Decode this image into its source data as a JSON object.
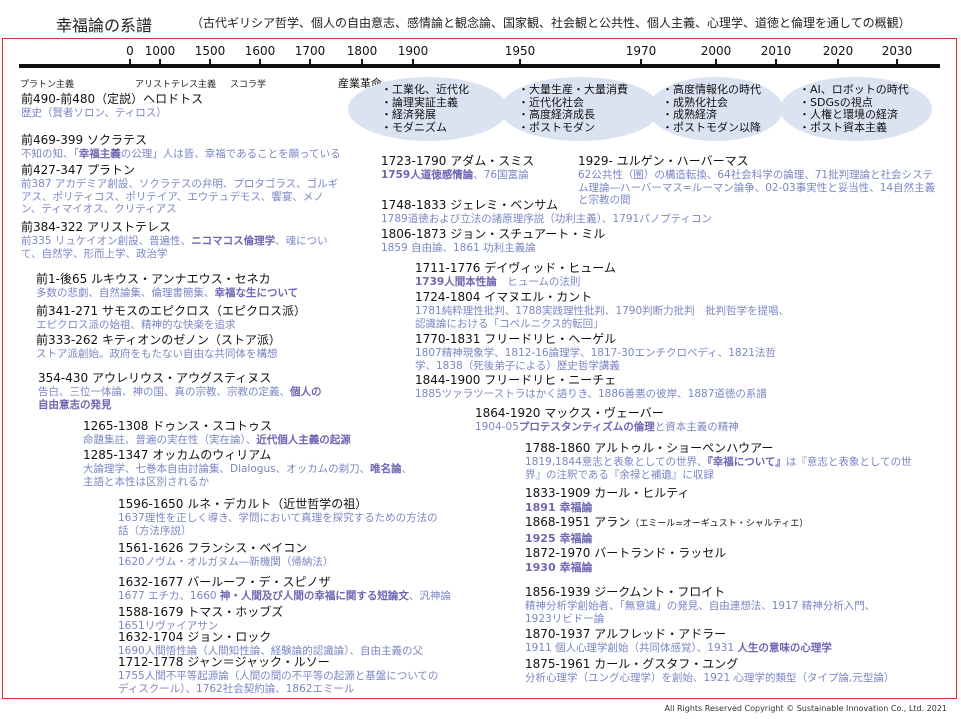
{
  "header": {
    "title": "幸福論の系譜",
    "subtitle": "（古代ギリシア哲学、個人の自由意志、感情論と観念論、国家観、社会観と公共性、個人主義、心理学、道徳と倫理を通しての概観）"
  },
  "timeline": {
    "years": [
      "0",
      "1000",
      "1500",
      "1600",
      "1700",
      "1800",
      "1900",
      "1950",
      "1970",
      "2000",
      "2010",
      "2020",
      "2030"
    ],
    "eras": [
      "プラトン主義",
      "アリストテレス主義",
      "スコラ学"
    ],
    "industrial_revolution": "産業革命"
  },
  "ovals": [
    {
      "items": [
        "・工業化、近代化",
        "・論理実証主義",
        "・経済発展",
        "・モダニズム"
      ]
    },
    {
      "items": [
        "・大量生産・大量消費",
        "・近代化社会",
        "・高度経済成長",
        "・ポストモダン"
      ]
    },
    {
      "items": [
        "・高度情報化の時代",
        "・成熟化社会",
        "・成熟経済",
        "・ポストモダン以降"
      ]
    },
    {
      "items": [
        "・AI、ロボットの時代",
        "・SDGsの視点",
        "・人権と環境の経済",
        "・ポスト資本主義"
      ]
    }
  ],
  "people": {
    "herodotus": {
      "name": "前490-前480（定説）ヘロドトス",
      "d1": "歴史（賢者ソロン、ティロス）"
    },
    "socrates": {
      "name": "前469-399 ソクラテス",
      "d1": "不知の知、「",
      "d2": "幸福主義",
      "d3": "の公理」人は皆、幸福であることを願っている"
    },
    "plato": {
      "name": "前427-347 プラトン",
      "d1": "前387 アカデミア創設、ソクラテスの弁明、プロタゴラス、ゴルギアス、ポリティコス、ポリテイア、エウテュデモス、饗宴、メノン、ティマイオス、クリティアス"
    },
    "aristotle": {
      "name": "前384-322 アリストテレス",
      "d1": "前335 リュケイオン創設、普遍性、",
      "d2": "ニコマコス倫理学",
      "d3": "、魂について、自然学、形而上学、政治学"
    },
    "seneca": {
      "name": "前1-後65 ルキウス・アンナエウス・セネカ",
      "d1": "多数の悲劇、自然論集、倫理書簡集、",
      "d2": "幸福な生について"
    },
    "epicurus": {
      "name": "前341-271 サモスのエピクロス（エピクロス派）",
      "d1": "エピクロス派の始祖、精神的な快楽を追求"
    },
    "zeno": {
      "name": "前333-262 キティオンのゼノン（ストア派）",
      "d1": "ストア派創始。政府をもたない自由な共同体を構想"
    },
    "augustine": {
      "name": "354-430 アウレリウス・アウグスティヌス",
      "d1": "告白、三位一体論、神の国、真の宗教、宗教の定義、",
      "d2": "個人の自由意志の発見"
    },
    "scotus": {
      "name": "1265-1308 ドゥンス・スコトゥス",
      "d1": "命題集註、普遍の実在性（実在論）、",
      "d2": "近代個人主義の起源"
    },
    "ockham": {
      "name": "1285-1347 オッカムのウィリアム",
      "d1": "大論理学、七巻本自由討論集、Dialogus、オッカムの剃刀、",
      "d2": "唯名論",
      "d3": "、主語と本性は区別されるか"
    },
    "descartes": {
      "name": "1596-1650 ルネ・デカルト（近世哲学の祖）",
      "d1": "1637理性を正しく導き、学問において真理を探究するための方法の話（方法序説）"
    },
    "bacon": {
      "name": "1561-1626 フランシス・ベイコン",
      "d1": "1620ノヴム・オルガヌム―新機関（帰納法）"
    },
    "spinoza": {
      "name": "1632-1677 バールーフ・デ・スピノザ",
      "d1": "1677 エチカ、1660 ",
      "d2": "神・人間及び人間の幸福に関する短論文",
      "d3": "、汎神論"
    },
    "hobbes": {
      "name": "1588-1679 トマス・ホッブズ",
      "d1": "1651リヴァイアサン"
    },
    "locke": {
      "name": "1632-1704 ジョン・ロック",
      "d1": "1690人間悟性論（人間知性論、経験論的認識論）、自由主義の父"
    },
    "rousseau": {
      "name": "1712-1778 ジャン＝ジャック・ルソー",
      "d1": "1755人間不平等起源論（人間の間の不平等の起源と基盤についてのディスクール）、1762社会契約論、1862エミール"
    },
    "smith": {
      "name": "1723-1790 アダム・スミス",
      "d1": "1759人道徳感情論",
      "d2": "、76国富論"
    },
    "bentham": {
      "name": "1748-1833 ジェレミ・ベンサム",
      "d1": "1789道徳および立法の諸原理序説（功利主義）、1791パノプティコン"
    },
    "mill": {
      "name": "1806-1873 ジョン・スチュアート・ミル",
      "d1": "1859 自由論、1861 功利主義論"
    },
    "habermas": {
      "name": "1929- ユルゲン・ハーバーマス",
      "d1": "62公共性（圏）の構造転換、64社会科学の論理、71批判理論と社会システム理論―ハーバーマス=ルーマン論争、02-03事実性と妥当性、14自然主義と宗教の間"
    },
    "hume": {
      "name": "1711-1776 デイヴィッド・ヒューム",
      "d1": "1739人間本性論",
      "d2": "　ヒュームの法則"
    },
    "kant": {
      "name": "1724-1804 イマヌエル・カント",
      "d1": "1781純粋理性批判、1788実践理性批判、1790判断力批判　批判哲学を提唱、認識論における「コペルニクス的転回」"
    },
    "hegel": {
      "name": "1770-1831 フリードリヒ・ヘーゲル",
      "d1": "1807精神現象学、1812-16論理学、1817-30エンチクロペディ、1821法哲学、1838（死後弟子による）歴史哲学講義"
    },
    "nietzsche": {
      "name": "1844-1900 フリードリヒ・ニーチェ",
      "d1": "1885ツァラツーストラはかく語りき、1886善悪の彼岸、1887道徳の系譜"
    },
    "weber": {
      "name": "1864-1920 マックス・ヴェーバー",
      "d1": "1904-05",
      "d2": "プロテスタンティズムの倫理",
      "d3": "と資本主義の精神"
    },
    "schopenhauer": {
      "name": "1788-1860 アルトゥル・ショーペンハウアー",
      "d1": "1819,1844意志と表象としての世界、",
      "d2": "『幸福について』",
      "d3": "は『意志と表象としての世界』の注釈である『余禄と補遺』に収録"
    },
    "hilty": {
      "name": "1833-1909 カール・ヒルティ",
      "hl": "1891 幸福論"
    },
    "alain": {
      "name": "1868-1951 アラン",
      "name_sub": "（エミール=オーギュスト・シャルティエ）",
      "hl": "1925 幸福論"
    },
    "russell": {
      "name": "1872-1970 バートランド・ラッセル",
      "hl": "1930 幸福論"
    },
    "freud": {
      "name": "1856-1939 ジークムント・フロイト",
      "d1": "精神分析学創始者、「無意識」の発見、自由連想法、1917 精神分析入門、1923リビドー論"
    },
    "adler": {
      "name": "1870-1937 アルフレッド・アドラー",
      "d1": "1911 個人心理学創始（共同体感覚）、1931 ",
      "d2": "人生の意味の心理学"
    },
    "jung": {
      "name": "1875-1961 カール・グスタフ・ユング",
      "d1": "分析心理学（ユング心理学）を創始、1921 心理学的類型（タイプ論,元型論）"
    }
  },
  "footer": {
    "copyright": "All Rights Reserved Copyright © Sustainable Innovation Co., Ltd. 2021"
  }
}
